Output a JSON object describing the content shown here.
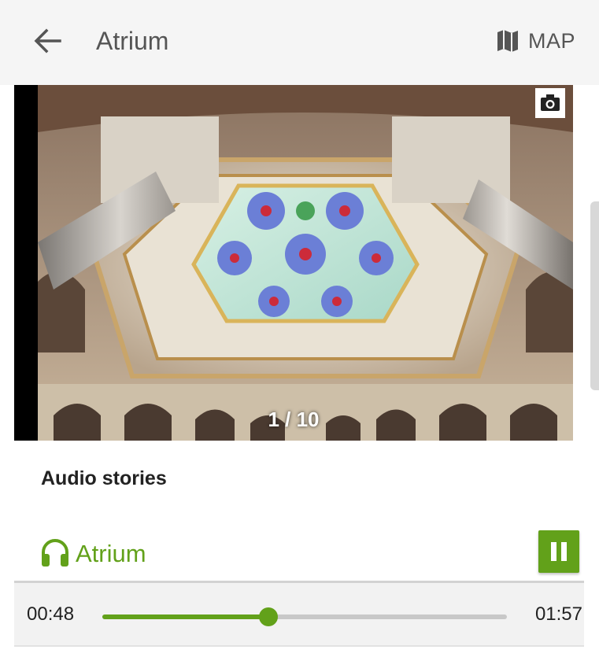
{
  "appbar": {
    "title": "Atrium",
    "map_label": "MAP"
  },
  "gallery": {
    "counter": "1 / 10",
    "current": 1,
    "total": 10
  },
  "audio": {
    "section_title": "Audio stories",
    "track_title": "Atrium",
    "time_current": "00:48",
    "time_total": "01:57",
    "progress": 0.41
  },
  "colors": {
    "accent": "#62a11a",
    "appbar_bg": "#f5f5f5",
    "text_secondary": "#555555"
  },
  "icons": {
    "back": "arrow-left-icon",
    "map": "map-icon",
    "camera": "camera-icon",
    "headphones": "headphones-icon",
    "pause": "pause-icon"
  }
}
